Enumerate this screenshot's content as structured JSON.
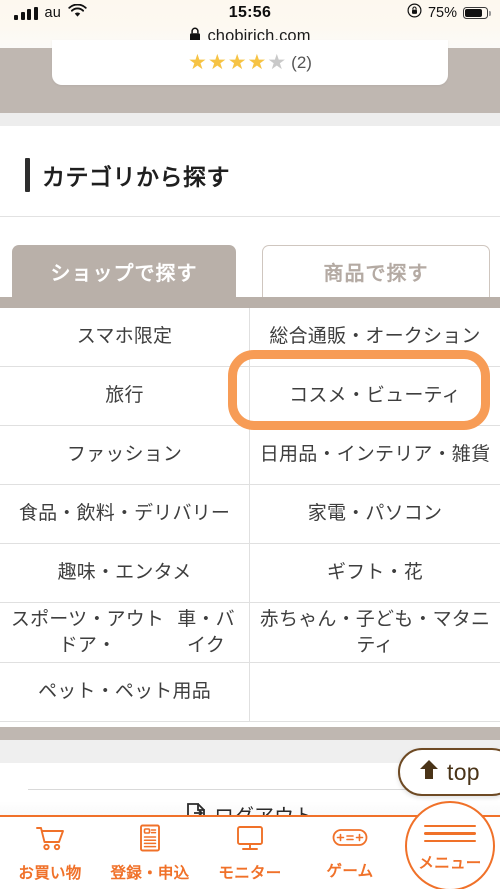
{
  "statusbar": {
    "carrier": "au",
    "time": "15:56",
    "battery_percent": "75%",
    "signal_icon": "signal-bars-icon",
    "wifi_icon": "wifi-icon",
    "rotation_lock_icon": "rotation-lock-icon",
    "battery_icon": "battery-icon"
  },
  "urlbar": {
    "lock_icon": "lock-icon",
    "url": "chobirich.com"
  },
  "review_card": {
    "filled_stars": 4,
    "total_stars": 5,
    "count_label": "(2)"
  },
  "section": {
    "title": "カテゴリから探す"
  },
  "tabs": [
    {
      "label": "ショップで探す",
      "active": true
    },
    {
      "label": "商品で探す",
      "active": false
    }
  ],
  "categories": [
    "スマホ限定",
    "総合通販・オークション",
    "旅行",
    "コスメ・ビューティ",
    "ファッション",
    "日用品・インテリア・雑貨",
    "食品・飲料・デリバリー",
    "家電・パソコン",
    "趣味・エンタメ",
    "ギフト・花",
    "スポーツ・アウトドア・\n車・バイク",
    "赤ちゃん・子ども・マタニティ",
    "ペット・ペット用品",
    ""
  ],
  "highlight": {
    "target_label": "コスメ・ビューティ",
    "color": "#f79c56"
  },
  "top_button": {
    "label": "top",
    "icon": "arrow-up-icon"
  },
  "footer": {
    "logout_label": "ログアウト",
    "logout_icon": "logout-icon"
  },
  "bottomnav": {
    "accent_color": "#f07129",
    "items": [
      {
        "label": "お買い物",
        "icon": "shopping-cart-icon"
      },
      {
        "label": "登録・申込",
        "icon": "document-form-icon"
      },
      {
        "label": "モニター",
        "icon": "monitor-icon"
      },
      {
        "label": "ゲーム",
        "icon": "gamepad-icon"
      },
      {
        "label": "メニュー",
        "icon": "hamburger-menu-icon"
      }
    ]
  }
}
